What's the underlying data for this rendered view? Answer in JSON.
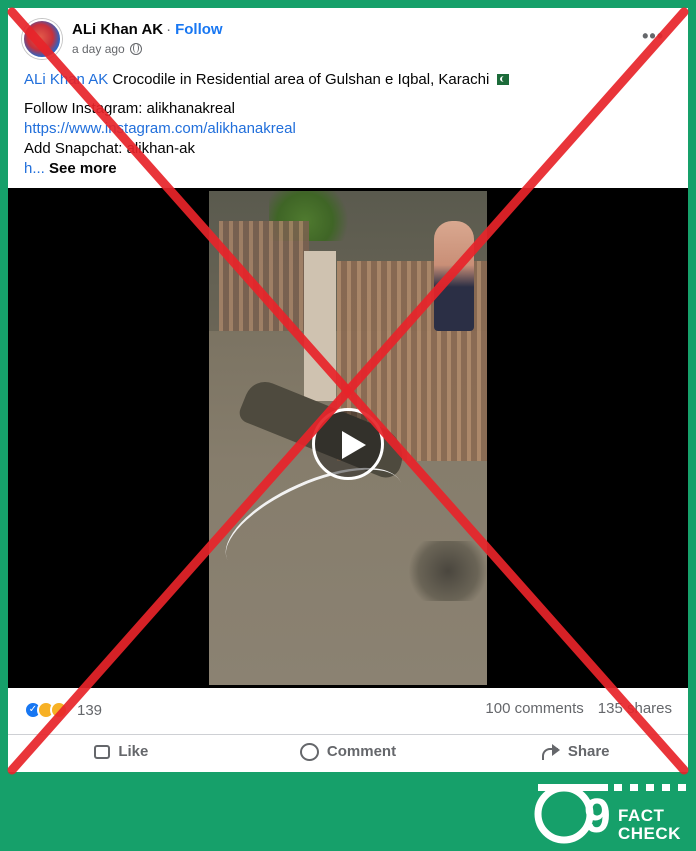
{
  "post": {
    "author": "ALi Khan AK",
    "separator": "·",
    "follow_label": "Follow",
    "time": "a day ago",
    "more_label": "•••",
    "text": {
      "mention": "ALi Khan AK",
      "headline": " Crocodile in Residential area of Gulshan e Iqbal, Karachi",
      "line_instagram": "Follow Instagram: alikhanakreal",
      "instagram_url": "https://www.instagram.com/alikhanakreal",
      "line_snapchat": "Add Snapchat: alikhan-ak",
      "truncated": "h...",
      "see_more": "See more"
    },
    "reactions_count": "139",
    "comments": "100 comments",
    "shares": "135 shares",
    "actions": {
      "like": "Like",
      "comment": "Comment",
      "share": "Share"
    }
  },
  "overlay": {
    "x_color": "#e8242a",
    "logo_number": "9",
    "logo_fact": "FACT",
    "logo_check": "CHECK"
  },
  "icons": [
    "globe-icon",
    "more-options-icon",
    "play-icon",
    "like-reaction-icon",
    "haha-reaction-icon",
    "wow-reaction-icon",
    "like-icon",
    "comment-icon",
    "share-icon",
    "pakistan-flag-icon"
  ],
  "colors": {
    "background": "#16a06a",
    "link": "#216fdb",
    "follow": "#1877f2"
  }
}
